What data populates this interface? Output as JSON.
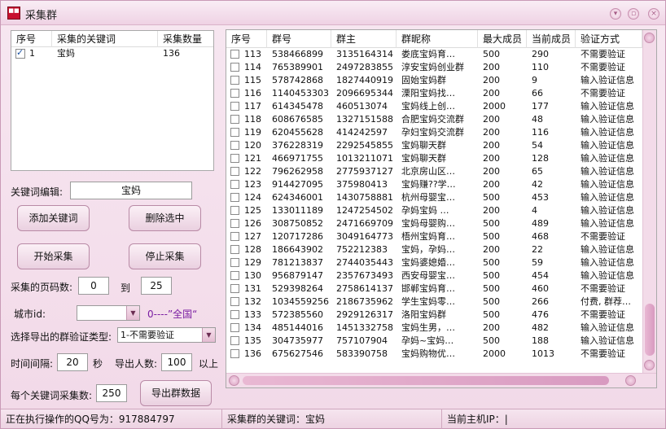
{
  "window": {
    "title": "采集群"
  },
  "keyword_list": {
    "columns": [
      "序号",
      "采集的关键词",
      "采集数量"
    ],
    "rows": [
      {
        "checked": true,
        "no": "1",
        "keyword": "宝妈",
        "count": "136"
      }
    ]
  },
  "keyword_edit": {
    "label": "关键词编辑:",
    "value": "宝妈"
  },
  "buttons": {
    "add_keyword": "添加关键词",
    "delete_selected": "删除选中",
    "start": "开始采集",
    "stop": "停止采集",
    "export": "导出群数据"
  },
  "pages": {
    "label": "采集的页码数:",
    "from": "0",
    "to_label": "到",
    "to": "25"
  },
  "city": {
    "label": "城市id:",
    "value": "",
    "link_text": "0----”全国“"
  },
  "verify_type": {
    "label": "选择导出的群验证类型:",
    "value": "1-不需要验证"
  },
  "interval": {
    "label": "时间间隔:",
    "value": "20",
    "unit": "秒",
    "export_count_label": "导出人数:",
    "export_count": "100",
    "above": "以上"
  },
  "per_keyword": {
    "label": "每个关键词采集数:",
    "value": "250"
  },
  "group_table": {
    "columns": [
      "序号",
      "群号",
      "群主",
      "群昵称",
      "最大成员",
      "当前成员",
      "验证方式"
    ],
    "rows": [
      [
        "113",
        "538466899",
        "3135164314",
        "娄底宝妈育…",
        "500",
        "290",
        "不需要验证"
      ],
      [
        "114",
        "765389901",
        "2497283855",
        "淳安宝妈创业群",
        "200",
        "110",
        "不需要验证"
      ],
      [
        "115",
        "578742868",
        "1827440919",
        "固始宝妈群",
        "200",
        "9",
        "输入验证信息"
      ],
      [
        "116",
        "1140453303",
        "2096695344",
        "溧阳宝妈找…",
        "200",
        "66",
        "不需要验证"
      ],
      [
        "117",
        "614345478",
        "460513074",
        "宝妈线上创…",
        "2000",
        "177",
        "输入验证信息"
      ],
      [
        "118",
        "608676585",
        "1327151588",
        "合肥宝妈交流群",
        "200",
        "48",
        "输入验证信息"
      ],
      [
        "119",
        "620455628",
        "414242597",
        "孕妇宝妈交流群",
        "200",
        "116",
        "输入验证信息"
      ],
      [
        "120",
        "376228319",
        "2292545855",
        "宝妈聊天群",
        "200",
        "54",
        "输入验证信息"
      ],
      [
        "121",
        "466971755",
        "1013211071",
        "宝妈聊天群",
        "200",
        "128",
        "输入验证信息"
      ],
      [
        "122",
        "796262958",
        "2775937127",
        "北京房山区…",
        "200",
        "65",
        "输入验证信息"
      ],
      [
        "123",
        "914427095",
        "375980413",
        "宝妈赚??学…",
        "200",
        "42",
        "输入验证信息"
      ],
      [
        "124",
        "624346001",
        "1430758881",
        "杭州母婴宝…",
        "500",
        "453",
        "输入验证信息"
      ],
      [
        "125",
        "133011189",
        "1247254502",
        "孕妈宝妈 …",
        "200",
        "4",
        "输入验证信息"
      ],
      [
        "126",
        "308750852",
        "2471669709",
        "宝妈母婴购…",
        "500",
        "489",
        "输入验证信息"
      ],
      [
        "127",
        "120717286",
        "3049164773",
        "梧州宝妈育…",
        "500",
        "468",
        "不需要验证"
      ],
      [
        "128",
        "186643902",
        "752212383",
        "宝妈，孕妈…",
        "200",
        "22",
        "输入验证信息"
      ],
      [
        "129",
        "781213837",
        "2744035443",
        "宝妈婆媳婚…",
        "500",
        "59",
        "输入验证信息"
      ],
      [
        "130",
        "956879147",
        "2357673493",
        "西安母婴宝…",
        "500",
        "454",
        "输入验证信息"
      ],
      [
        "131",
        "529398264",
        "2758614137",
        "邯郸宝妈育…",
        "500",
        "460",
        "不需要验证"
      ],
      [
        "132",
        "1034559256",
        "2186735962",
        "学生宝妈零…",
        "500",
        "266",
        "付费, 群荐…"
      ],
      [
        "133",
        "572385560",
        "2929126317",
        "洛阳宝妈群",
        "500",
        "476",
        "不需要验证"
      ],
      [
        "134",
        "485144016",
        "1451332758",
        "宝妈生男，…",
        "200",
        "482",
        "输入验证信息"
      ],
      [
        "135",
        "304735977",
        "757107904",
        "孕妈~宝妈…",
        "500",
        "188",
        "输入验证信息"
      ],
      [
        "136",
        "675627546",
        "583390758",
        "宝妈购物优…",
        "2000",
        "1013",
        "不需要验证"
      ]
    ]
  },
  "status": {
    "qq": "正在执行操作的QQ号为：917884797",
    "keyword": "采集群的关键词：宝妈",
    "host_ip": "当前主机IP：|"
  },
  "colors": {
    "link_purple": "#7b1fa2",
    "accent_pink": "#e6b9d3"
  }
}
